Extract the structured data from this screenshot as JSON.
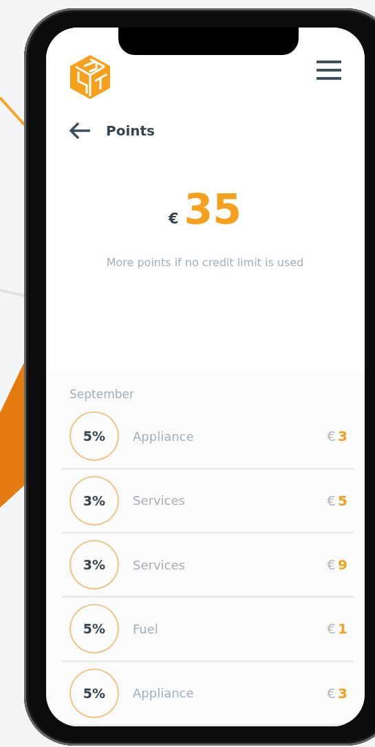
{
  "header": {
    "title": "Points"
  },
  "balance": {
    "currency": "€",
    "amount": "35",
    "note": "More points if no credit limit is used"
  },
  "section": {
    "title": "September",
    "rows": [
      {
        "rate": "5%",
        "category": "Appliance",
        "currency": "€",
        "amount": "3"
      },
      {
        "rate": "3%",
        "category": "Services",
        "currency": "€",
        "amount": "5"
      },
      {
        "rate": "3%",
        "category": "Services",
        "currency": "€",
        "amount": "9"
      },
      {
        "rate": "5%",
        "category": "Fuel",
        "currency": "€",
        "amount": "1"
      },
      {
        "rate": "5%",
        "category": "Appliance",
        "currency": "€",
        "amount": "3"
      }
    ]
  }
}
